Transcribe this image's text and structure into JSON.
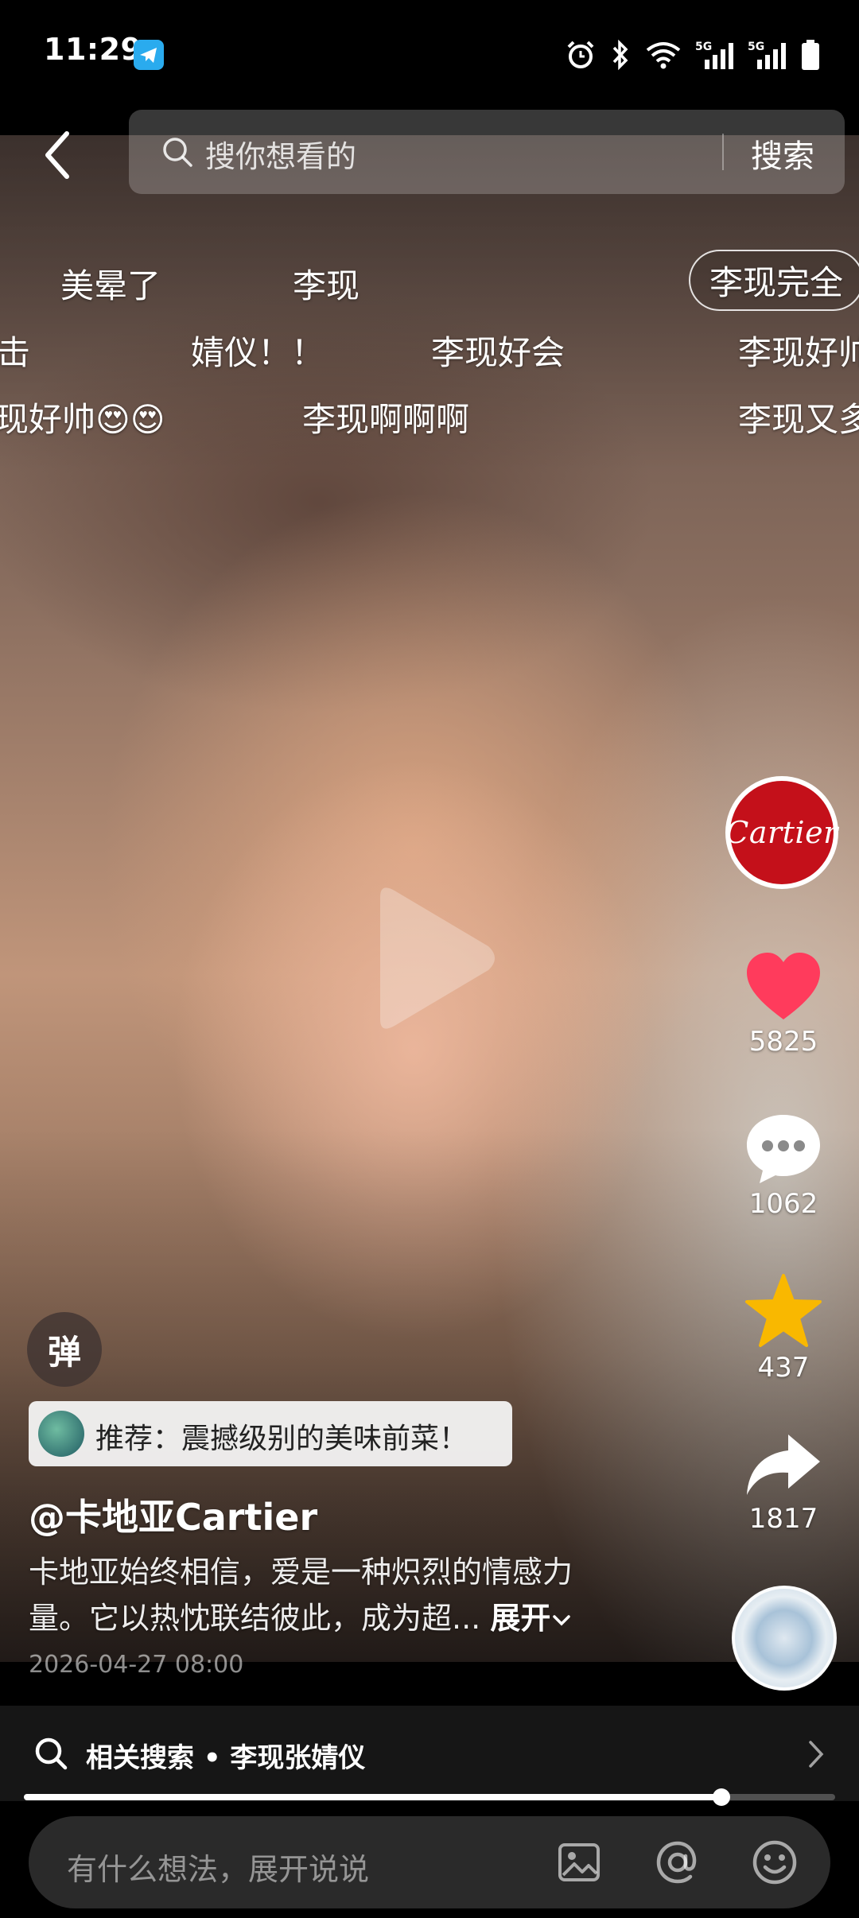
{
  "status_bar": {
    "time": "11:29",
    "app_icon": "telegram-icon",
    "icons": [
      "alarm-icon",
      "bluetooth-icon",
      "wifi-icon",
      "5g-signal-icon",
      "5g-signal-icon",
      "battery-icon"
    ],
    "network_labels": [
      "5G",
      "5G"
    ]
  },
  "search": {
    "placeholder": "搜你想看的",
    "button_label": "搜索"
  },
  "danmaku": [
    "美晕了",
    "李现",
    "李现完全",
    "击",
    "婧仪！！",
    "李现好会",
    "李现好帅",
    "现好帅😍😍",
    "李现啊啊啊",
    "李现又多"
  ],
  "actions": {
    "avatar_brand": "Cartier",
    "like_count": "5825",
    "comment_count": "1062",
    "favorite_count": "437",
    "share_count": "1817"
  },
  "post": {
    "danmaku_toggle_label": "弹",
    "recommend_text": "推荐：震撼级别的美味前菜！",
    "author": "@卡地亚Cartier",
    "description_line1": "卡地亚始终相信，爱是一种炽烈的情感力",
    "description_line2": "量。它以热忱联结彼此，成为超...",
    "expand_label": "展开",
    "date": "2026-04-27 08:00"
  },
  "related_search": {
    "text": "相关搜索 • 李现张婧仪"
  },
  "playback": {
    "progress_fraction": 0.86
  },
  "comment": {
    "placeholder": "有什么想法，展开说说"
  },
  "colors": {
    "like": "#ff3b5c",
    "favorite": "#f9b800",
    "cartier_red": "#c4101a"
  }
}
